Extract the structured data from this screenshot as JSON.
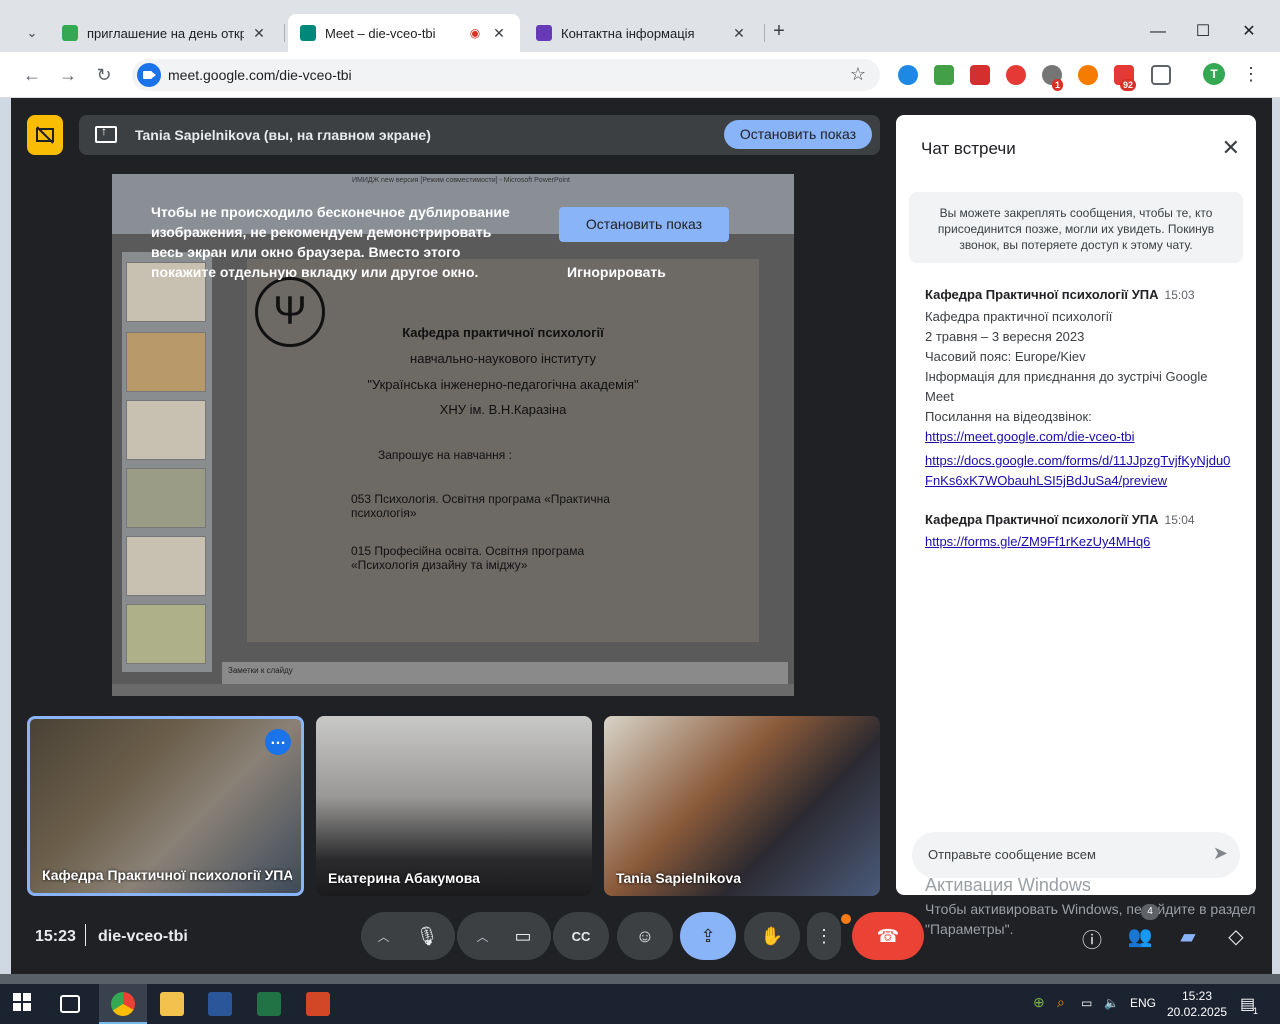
{
  "browser": {
    "tabs": [
      {
        "title": "приглашение на день открітіх",
        "favicon_color": "#34a853"
      },
      {
        "title": "Meet – die-vceo-tbi",
        "favicon_color": "#00897b",
        "active": true
      },
      {
        "title": "Контактна інформація",
        "favicon_color": "#673ab7"
      }
    ],
    "url": "meet.google.com/die-vceo-tbi",
    "profile_initial": "T",
    "ext_badges": {
      "b1": "1",
      "b2": "92"
    }
  },
  "presentation": {
    "banner_label": "Tania Sapielnikova (вы, на главном экране)",
    "stop_label": "Остановить показ",
    "warning_text": "Чтобы не происходило бесконечное дублирование изображения, не рекомендуем демонстрировать весь экран или окно браузера. Вместо этого покажите отдельную вкладку или другое окно.",
    "warning_stop": "Остановить показ",
    "warning_ignore": "Игнорировать",
    "slide": {
      "line1": "Кафедра практичної психології",
      "line2": "навчально-наукового інституту",
      "line3": "\"Українська інженерно-педагогічна академія\"",
      "line4": "ХНУ ім. В.Н.Каразіна",
      "invite": "Запрошує на навчання :",
      "prog1": "053 Психологія. Освітня програма «Практична психологія»",
      "prog2": "015 Професійна освіта. Освітня програма «Психологія дизайну та іміджу»",
      "notes": "Заметки к слайду",
      "window_title": "ИМИДЖ new версия [Режим совместимости] - Microsoft PowerPoint"
    }
  },
  "participants": [
    {
      "name": "Кафедра Практичної психології УПА"
    },
    {
      "name": "Екатерина Абакумова"
    },
    {
      "name": "Tania Sapielnikova"
    }
  ],
  "chat": {
    "title": "Чат встречи",
    "pin_notice": "Вы можете закреплять сообщения, чтобы те, кто присоединится позже, могли их увидеть. Покинув звонок, вы потеряете доступ к этому чату.",
    "messages": [
      {
        "sender": "Кафедра Практичної психології УПА",
        "time": "15:03",
        "lines": [
          "Кафедра практичної психології",
          "2 травня – 3 вересня 2023",
          "Часовий пояс: Europe/Kiev",
          "Інформація для приєднання до зустрічі Google Meet",
          "Посилання на відеодзвінок:"
        ],
        "links": [
          "https://meet.google.com/die-vceo-tbi",
          "https://docs.google.com/forms/d/11JJpzgTvjfKyNjdu0FnKs6xK7WObauhLSI5jBdJuSa4/preview"
        ]
      },
      {
        "sender": "Кафедра Практичної психології УПА",
        "time": "15:04",
        "links": [
          "https://forms.gle/ZM9Ff1rKezUy4MHq6"
        ]
      }
    ],
    "input_placeholder": "Отправьте сообщение всем"
  },
  "windows_watermark": {
    "title": "Активация Windows",
    "text": "Чтобы активировать Windows, перейдите в раздел \"Параметры\"."
  },
  "controls": {
    "clock": "15:23",
    "meeting_code": "die-vceo-tbi",
    "participant_count": "4"
  },
  "taskbar": {
    "lang": "ENG",
    "time": "15:23",
    "date": "20.02.2025",
    "notif_count": "1"
  },
  "colors": {
    "meet_bg": "#202124",
    "accent_blue": "#8ab4f8",
    "hangup_red": "#ea4335",
    "present_yellow": "#fbbc04"
  }
}
